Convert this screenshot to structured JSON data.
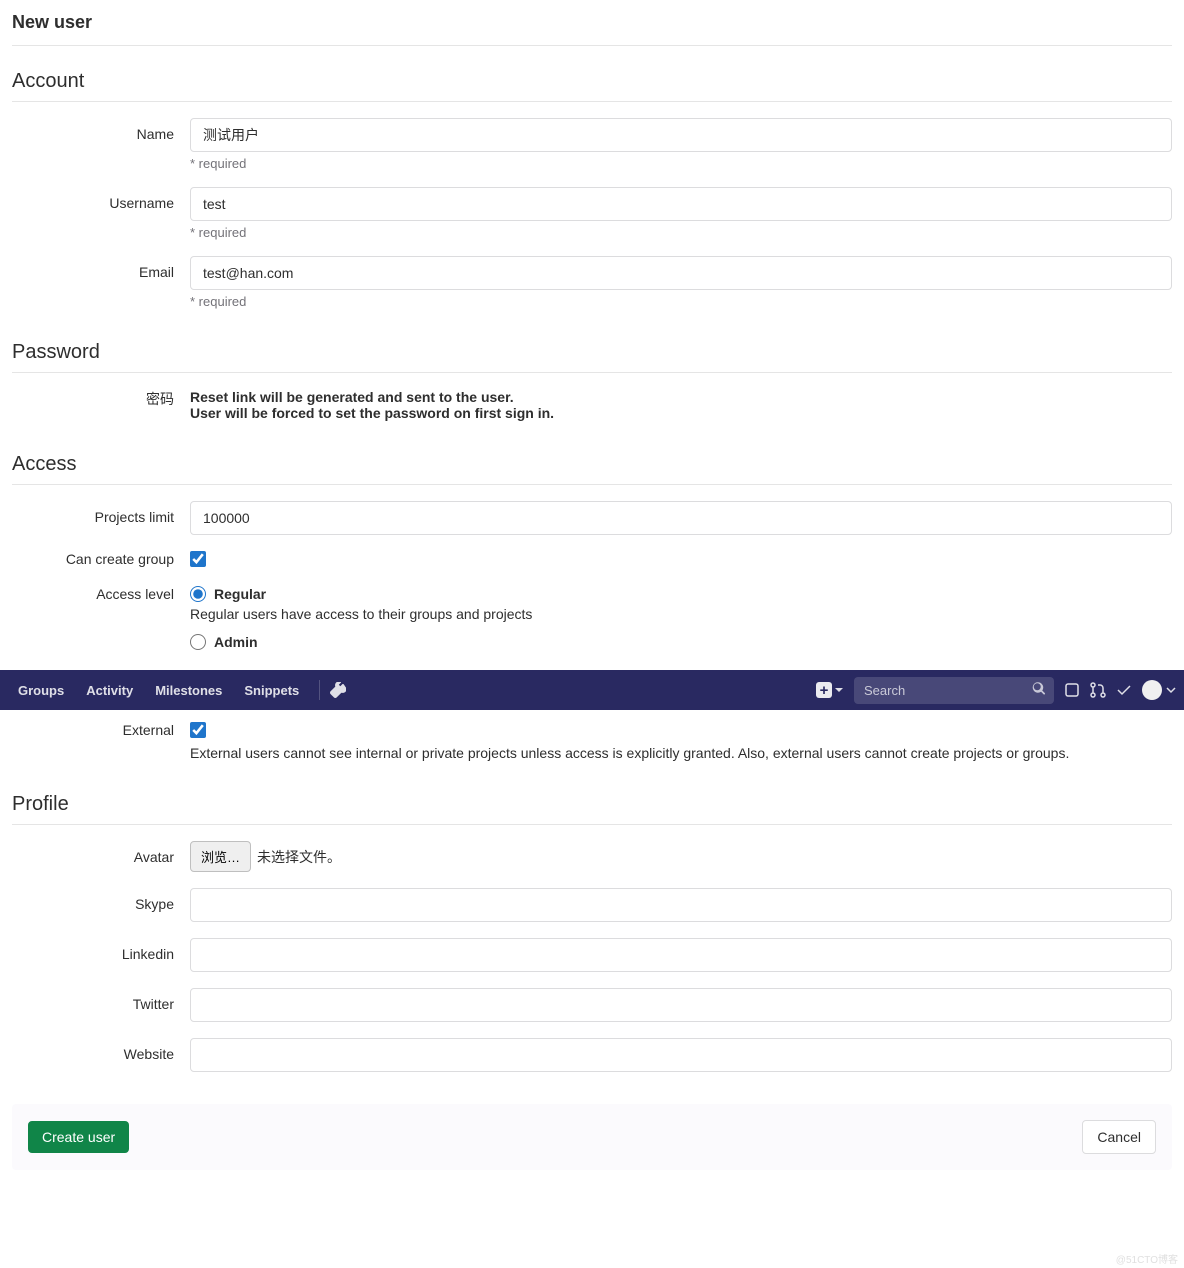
{
  "page": {
    "title": "New user"
  },
  "sections": {
    "account": {
      "title": "Account",
      "name_label": "Name",
      "name_value": "测试用户",
      "username_label": "Username",
      "username_value": "test",
      "email_label": "Email",
      "email_value": "test@han.com",
      "required_text": "* required"
    },
    "password": {
      "title": "Password",
      "label": "密码",
      "note_line1": "Reset link will be generated and sent to the user.",
      "note_line2": "User will be forced to set the password on first sign in."
    },
    "access": {
      "title": "Access",
      "projects_limit_label": "Projects limit",
      "projects_limit_value": "100000",
      "can_create_group_label": "Can create group",
      "can_create_group_checked": true,
      "access_level_label": "Access level",
      "regular_label": "Regular",
      "regular_desc": "Regular users have access to their groups and projects",
      "admin_label": "Admin",
      "external_label": "External",
      "external_checked": true,
      "external_desc": "External users cannot see internal or private projects unless access is explicitly granted. Also, external users cannot create projects or groups."
    },
    "profile": {
      "title": "Profile",
      "avatar_label": "Avatar",
      "avatar_browse": "浏览…",
      "avatar_no_file": "未选择文件。",
      "skype_label": "Skype",
      "linkedin_label": "Linkedin",
      "twitter_label": "Twitter",
      "website_label": "Website"
    }
  },
  "nav": {
    "groups": "Groups",
    "activity": "Activity",
    "milestones": "Milestones",
    "snippets": "Snippets",
    "search_placeholder": "Search"
  },
  "actions": {
    "create": "Create user",
    "cancel": "Cancel"
  },
  "watermark": "@51CTO博客"
}
